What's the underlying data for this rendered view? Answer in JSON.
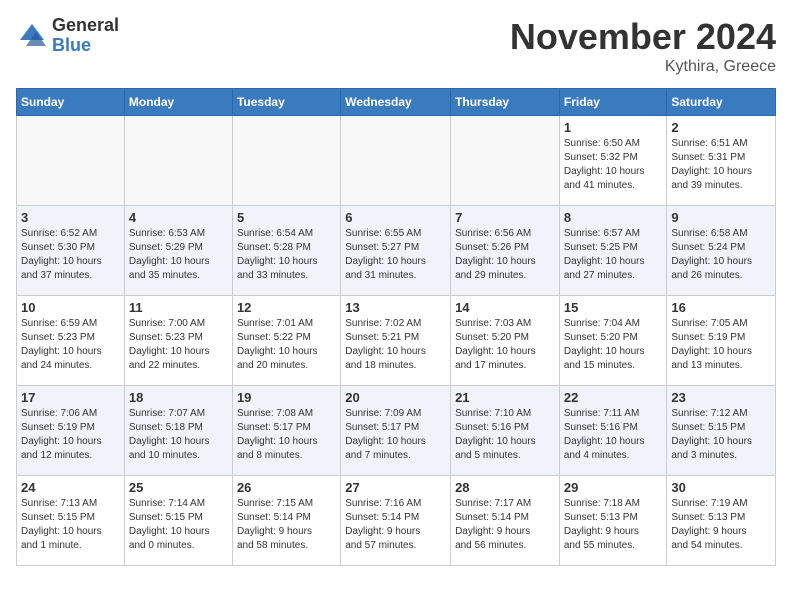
{
  "header": {
    "logo_general": "General",
    "logo_blue": "Blue",
    "month_title": "November 2024",
    "location": "Kythira, Greece"
  },
  "weekdays": [
    "Sunday",
    "Monday",
    "Tuesday",
    "Wednesday",
    "Thursday",
    "Friday",
    "Saturday"
  ],
  "weeks": [
    [
      {
        "day": "",
        "info": ""
      },
      {
        "day": "",
        "info": ""
      },
      {
        "day": "",
        "info": ""
      },
      {
        "day": "",
        "info": ""
      },
      {
        "day": "",
        "info": ""
      },
      {
        "day": "1",
        "info": "Sunrise: 6:50 AM\nSunset: 5:32 PM\nDaylight: 10 hours\nand 41 minutes."
      },
      {
        "day": "2",
        "info": "Sunrise: 6:51 AM\nSunset: 5:31 PM\nDaylight: 10 hours\nand 39 minutes."
      }
    ],
    [
      {
        "day": "3",
        "info": "Sunrise: 6:52 AM\nSunset: 5:30 PM\nDaylight: 10 hours\nand 37 minutes."
      },
      {
        "day": "4",
        "info": "Sunrise: 6:53 AM\nSunset: 5:29 PM\nDaylight: 10 hours\nand 35 minutes."
      },
      {
        "day": "5",
        "info": "Sunrise: 6:54 AM\nSunset: 5:28 PM\nDaylight: 10 hours\nand 33 minutes."
      },
      {
        "day": "6",
        "info": "Sunrise: 6:55 AM\nSunset: 5:27 PM\nDaylight: 10 hours\nand 31 minutes."
      },
      {
        "day": "7",
        "info": "Sunrise: 6:56 AM\nSunset: 5:26 PM\nDaylight: 10 hours\nand 29 minutes."
      },
      {
        "day": "8",
        "info": "Sunrise: 6:57 AM\nSunset: 5:25 PM\nDaylight: 10 hours\nand 27 minutes."
      },
      {
        "day": "9",
        "info": "Sunrise: 6:58 AM\nSunset: 5:24 PM\nDaylight: 10 hours\nand 26 minutes."
      }
    ],
    [
      {
        "day": "10",
        "info": "Sunrise: 6:59 AM\nSunset: 5:23 PM\nDaylight: 10 hours\nand 24 minutes."
      },
      {
        "day": "11",
        "info": "Sunrise: 7:00 AM\nSunset: 5:23 PM\nDaylight: 10 hours\nand 22 minutes."
      },
      {
        "day": "12",
        "info": "Sunrise: 7:01 AM\nSunset: 5:22 PM\nDaylight: 10 hours\nand 20 minutes."
      },
      {
        "day": "13",
        "info": "Sunrise: 7:02 AM\nSunset: 5:21 PM\nDaylight: 10 hours\nand 18 minutes."
      },
      {
        "day": "14",
        "info": "Sunrise: 7:03 AM\nSunset: 5:20 PM\nDaylight: 10 hours\nand 17 minutes."
      },
      {
        "day": "15",
        "info": "Sunrise: 7:04 AM\nSunset: 5:20 PM\nDaylight: 10 hours\nand 15 minutes."
      },
      {
        "day": "16",
        "info": "Sunrise: 7:05 AM\nSunset: 5:19 PM\nDaylight: 10 hours\nand 13 minutes."
      }
    ],
    [
      {
        "day": "17",
        "info": "Sunrise: 7:06 AM\nSunset: 5:19 PM\nDaylight: 10 hours\nand 12 minutes."
      },
      {
        "day": "18",
        "info": "Sunrise: 7:07 AM\nSunset: 5:18 PM\nDaylight: 10 hours\nand 10 minutes."
      },
      {
        "day": "19",
        "info": "Sunrise: 7:08 AM\nSunset: 5:17 PM\nDaylight: 10 hours\nand 8 minutes."
      },
      {
        "day": "20",
        "info": "Sunrise: 7:09 AM\nSunset: 5:17 PM\nDaylight: 10 hours\nand 7 minutes."
      },
      {
        "day": "21",
        "info": "Sunrise: 7:10 AM\nSunset: 5:16 PM\nDaylight: 10 hours\nand 5 minutes."
      },
      {
        "day": "22",
        "info": "Sunrise: 7:11 AM\nSunset: 5:16 PM\nDaylight: 10 hours\nand 4 minutes."
      },
      {
        "day": "23",
        "info": "Sunrise: 7:12 AM\nSunset: 5:15 PM\nDaylight: 10 hours\nand 3 minutes."
      }
    ],
    [
      {
        "day": "24",
        "info": "Sunrise: 7:13 AM\nSunset: 5:15 PM\nDaylight: 10 hours\nand 1 minute."
      },
      {
        "day": "25",
        "info": "Sunrise: 7:14 AM\nSunset: 5:15 PM\nDaylight: 10 hours\nand 0 minutes."
      },
      {
        "day": "26",
        "info": "Sunrise: 7:15 AM\nSunset: 5:14 PM\nDaylight: 9 hours\nand 58 minutes."
      },
      {
        "day": "27",
        "info": "Sunrise: 7:16 AM\nSunset: 5:14 PM\nDaylight: 9 hours\nand 57 minutes."
      },
      {
        "day": "28",
        "info": "Sunrise: 7:17 AM\nSunset: 5:14 PM\nDaylight: 9 hours\nand 56 minutes."
      },
      {
        "day": "29",
        "info": "Sunrise: 7:18 AM\nSunset: 5:13 PM\nDaylight: 9 hours\nand 55 minutes."
      },
      {
        "day": "30",
        "info": "Sunrise: 7:19 AM\nSunset: 5:13 PM\nDaylight: 9 hours\nand 54 minutes."
      }
    ]
  ]
}
